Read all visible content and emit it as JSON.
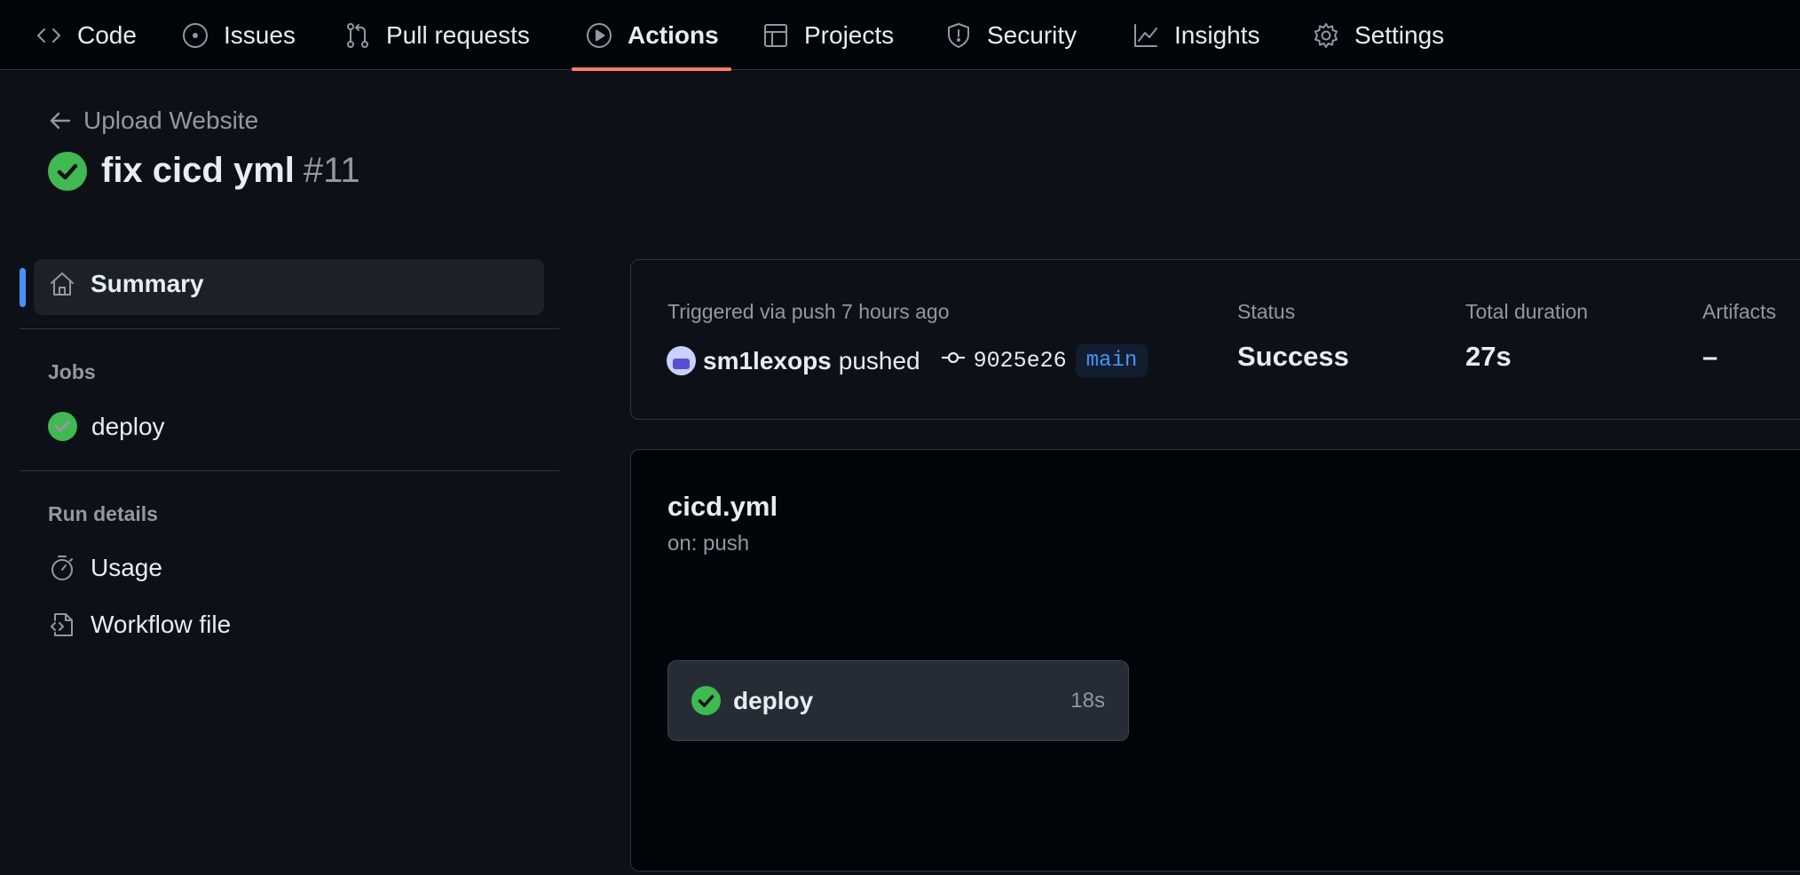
{
  "nav": {
    "tabs": [
      {
        "label": "Code",
        "icon": "code-icon"
      },
      {
        "label": "Issues",
        "icon": "issue-opened-icon"
      },
      {
        "label": "Pull requests",
        "icon": "git-pull-request-icon"
      },
      {
        "label": "Actions",
        "icon": "play-icon",
        "active": true
      },
      {
        "label": "Projects",
        "icon": "table-icon"
      },
      {
        "label": "Security",
        "icon": "shield-icon"
      },
      {
        "label": "Insights",
        "icon": "graph-icon"
      },
      {
        "label": "Settings",
        "icon": "gear-icon"
      }
    ]
  },
  "run": {
    "back_label": "Upload Website",
    "title": "fix cicd yml",
    "number": "#11",
    "status_color": "#3fb950"
  },
  "sidebar": {
    "summary_label": "Summary",
    "jobs_heading": "Jobs",
    "jobs": [
      {
        "label": "deploy",
        "status": "success"
      }
    ],
    "run_details_heading": "Run details",
    "details": [
      {
        "label": "Usage",
        "icon": "stopwatch-icon"
      },
      {
        "label": "Workflow file",
        "icon": "file-code-icon"
      }
    ]
  },
  "summary": {
    "trigger_text": "Triggered via push 7 hours ago",
    "actor": "sm1lexops",
    "action": "pushed",
    "commit_sha": "9025e26",
    "branch": "main",
    "status_label": "Status",
    "status_value": "Success",
    "duration_label": "Total duration",
    "duration_value": "27s",
    "artifacts_label": "Artifacts",
    "artifacts_value": "–"
  },
  "workflow": {
    "file_name": "cicd.yml",
    "trigger": "on: push",
    "jobs": [
      {
        "name": "deploy",
        "duration": "18s",
        "status": "success"
      }
    ]
  },
  "colors": {
    "accent_underline": "#f78166",
    "link_blue": "#4493f8",
    "success_green": "#3fb950",
    "background": "#0d1117"
  }
}
